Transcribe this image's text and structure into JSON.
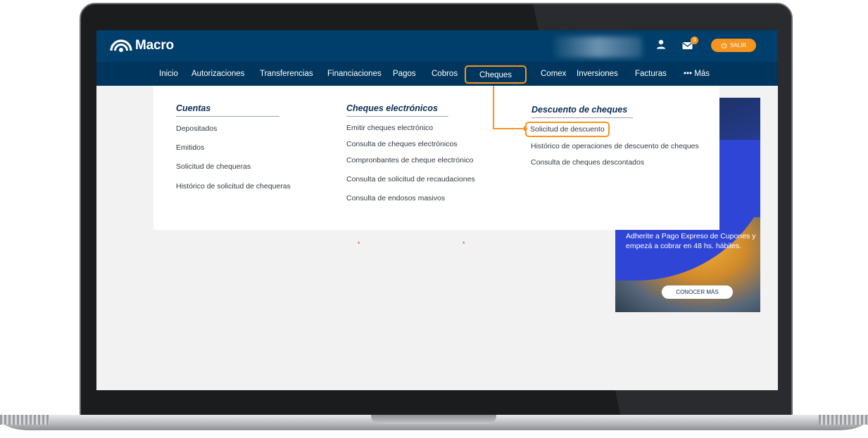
{
  "header": {
    "brand": "Macro",
    "notifications_count": "3",
    "logout_label": "SALIR",
    "icons": {
      "user": "user-icon",
      "mail": "mail-icon",
      "power": "power-icon"
    }
  },
  "nav": {
    "items": [
      "Inicio",
      "Autorizaciones",
      "Transferencias",
      "Financiaciones",
      "Pagos",
      "Cobros",
      "Cheques",
      "Comex",
      "Inversiones",
      "Facturas",
      "Más"
    ],
    "active": "Cheques",
    "more_icon": "ellipsis-icon"
  },
  "menu": {
    "cuentas": {
      "title": "Cuentas",
      "links": [
        "Depositados",
        "Emitidos",
        "Solicitud de chequeras",
        "Histórico de solicitud de chequeras"
      ]
    },
    "electronicos": {
      "title": "Cheques electrónicos",
      "links": [
        "Emitir cheques electrónico",
        "Consulta de cheques electrónicos",
        "Compronbantes de cheque electrónico",
        "Consulta de solicitud de recaudaciones",
        "Consulta de endosos masivos"
      ]
    },
    "descuento": {
      "title": "Descuento de cheques",
      "links": [
        "Solicitud de descuento",
        "Histórico de operaciones de descuento de cheques",
        "Consulta de cheques descontados"
      ]
    }
  },
  "ad": {
    "text": "Adherite a Pago Expreso de Cupones y empezá a cobrar en 48 hs. hábiles.",
    "cta": "CONOCER MÁS"
  },
  "page": {
    "required_mark": "*"
  },
  "colors": {
    "topbar": "#003f6b",
    "navbar": "#00365d",
    "accent": "#f7941d",
    "heading": "#0a2c52"
  }
}
